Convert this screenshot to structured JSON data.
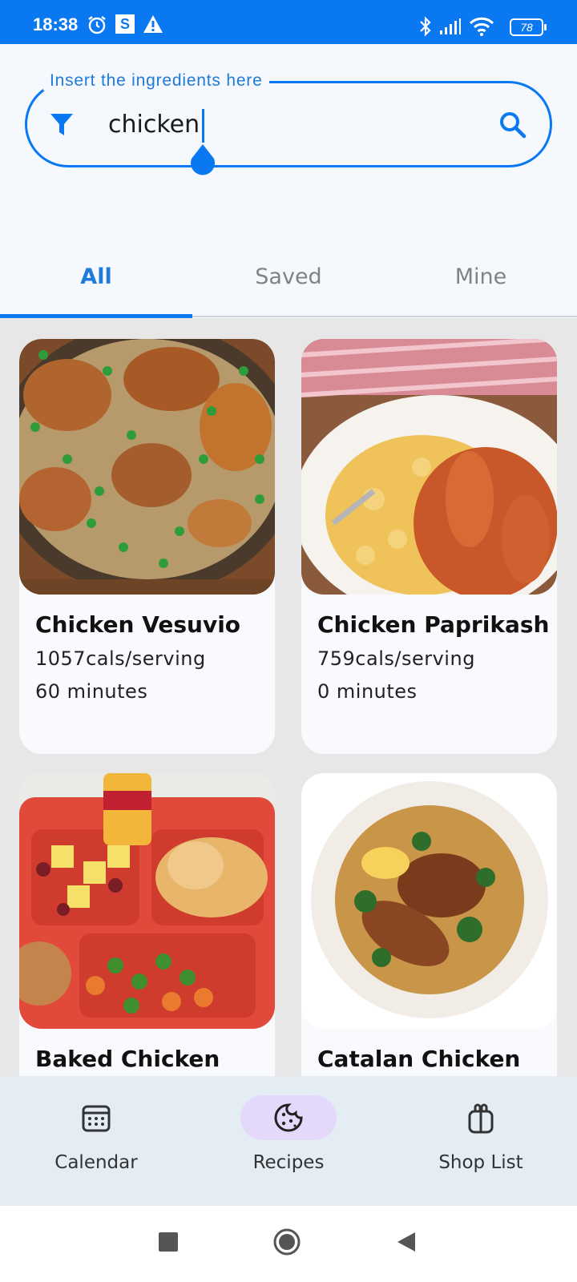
{
  "status_bar": {
    "time": "18:38",
    "battery": "78",
    "icons": [
      "alarm-icon",
      "s-app-icon",
      "warning-icon",
      "bluetooth-icon",
      "signal-icon",
      "wifi-icon",
      "battery-icon"
    ]
  },
  "search": {
    "label": "Insert the ingredients here",
    "value": "chicken"
  },
  "tabs": [
    {
      "label": "All",
      "active": true
    },
    {
      "label": "Saved",
      "active": false
    },
    {
      "label": "Mine",
      "active": false
    }
  ],
  "recipes": [
    {
      "title": "Chicken Vesuvio",
      "calories": "1057cals/serving",
      "time": "60 minutes"
    },
    {
      "title": "Chicken Paprikash",
      "calories": "759cals/serving",
      "time": "0 minutes"
    },
    {
      "title": "Baked Chicken"
    },
    {
      "title": "Catalan Chicken"
    }
  ],
  "bottom_nav": [
    {
      "label": "Calendar",
      "icon": "calendar-icon",
      "active": false
    },
    {
      "label": "Recipes",
      "icon": "cookie-icon",
      "active": true
    },
    {
      "label": "Shop List",
      "icon": "gift-bag-icon",
      "active": false
    }
  ],
  "colors": {
    "accent": "#0a79f1",
    "nav_active": "#e4d8fb",
    "background": "#f5f8fc"
  }
}
